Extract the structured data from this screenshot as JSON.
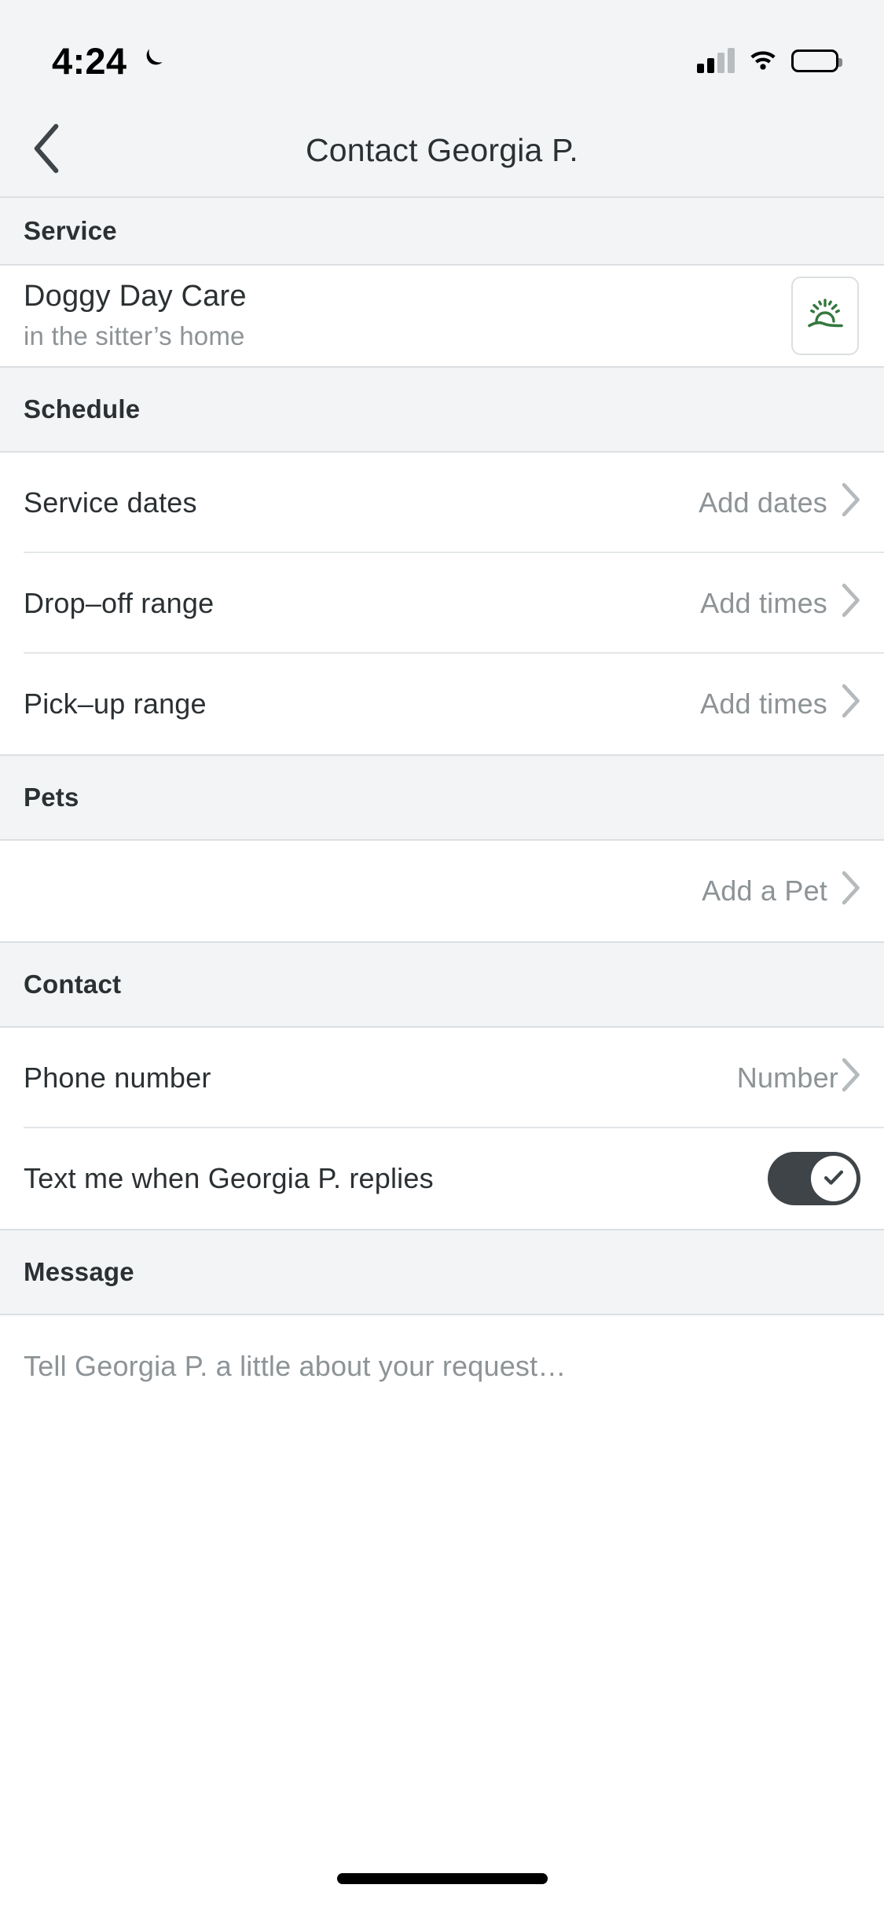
{
  "status_bar": {
    "time": "4:24",
    "dnd_icon": "crescent-moon-icon",
    "signal_icon": "cellular-signal-icon",
    "wifi_icon": "wifi-icon",
    "battery_icon": "battery-full-icon"
  },
  "nav": {
    "back_icon": "chevron-left-icon",
    "title": "Contact Georgia P."
  },
  "sections": {
    "service": {
      "header": "Service",
      "title": "Doggy Day Care",
      "subtitle": "in the sitter’s home",
      "badge_icon": "sunrise-icon",
      "badge_color": "#35783f"
    },
    "schedule": {
      "header": "Schedule",
      "rows": [
        {
          "label": "Service dates",
          "value": "Add dates",
          "chevron": "chevron-right-icon"
        },
        {
          "label": "Drop–off range",
          "value": "Add times",
          "chevron": "chevron-right-icon"
        },
        {
          "label": "Pick–up range",
          "value": "Add times",
          "chevron": "chevron-right-icon"
        }
      ]
    },
    "pets": {
      "header": "Pets",
      "row": {
        "label": "",
        "value": "Add a Pet",
        "chevron": "chevron-right-icon"
      }
    },
    "contact": {
      "header": "Contact",
      "phone": {
        "label": "Phone number",
        "value": "Number",
        "chevron": "chevron-right-icon"
      },
      "text_me": {
        "label": "Text me when Georgia P. replies",
        "toggle_on": true,
        "toggle_icon": "check-icon",
        "toggle_color": "#3e4447"
      }
    },
    "message": {
      "header": "Message",
      "placeholder": "Tell Georgia P. a little about your request…"
    }
  },
  "home_indicator": "home-indicator-bar"
}
